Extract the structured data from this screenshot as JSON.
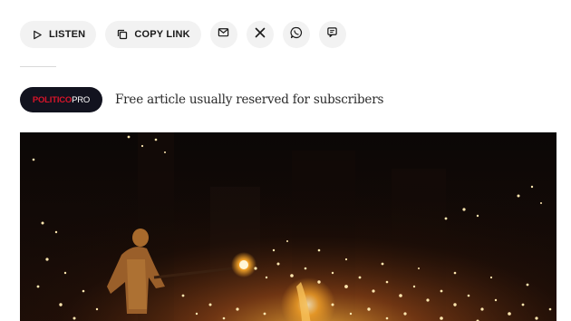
{
  "share": {
    "listen_label": "LISTEN",
    "copy_label": "COPY LINK",
    "icons": [
      "play-icon",
      "copy-link-icon",
      "mail-icon",
      "x-icon",
      "whatsapp-icon",
      "message-icon"
    ]
  },
  "pro": {
    "brand": "POLITICO",
    "suffix": "PRO",
    "note": "Free article usually reserved for subscribers",
    "brand_color": "#d7142a",
    "badge_bg": "#12131f"
  }
}
